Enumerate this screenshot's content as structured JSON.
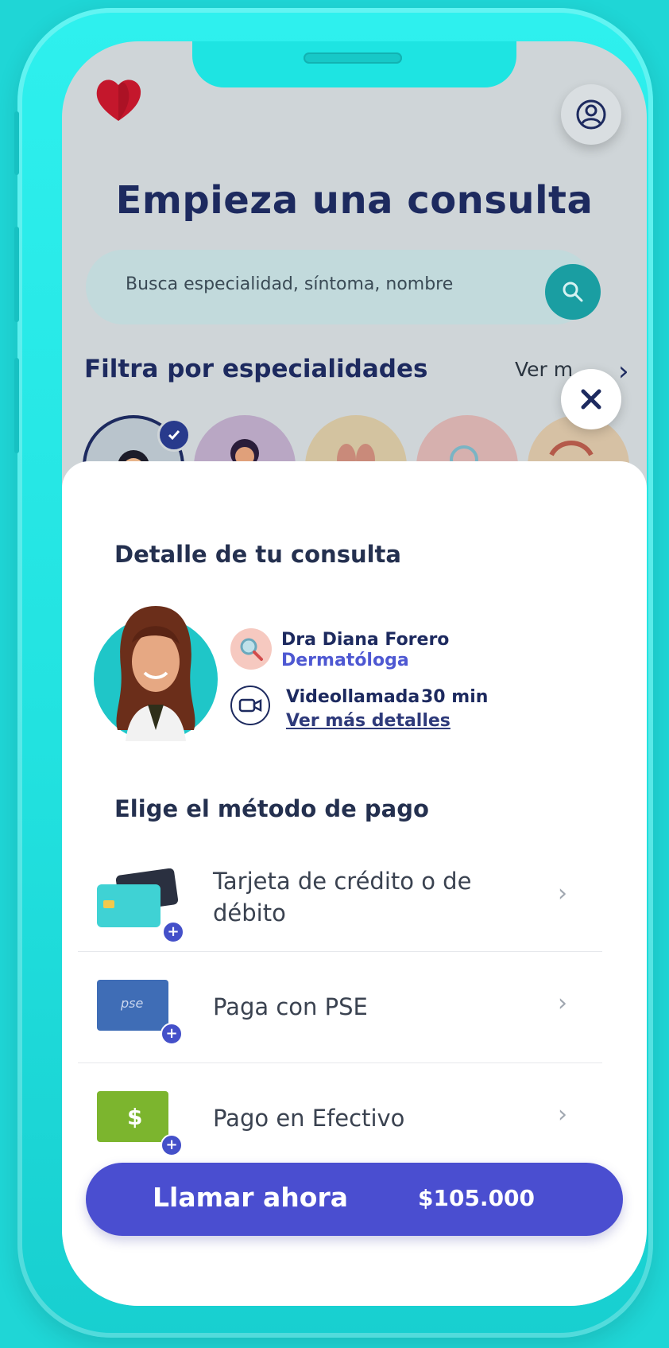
{
  "header": {
    "title": "Empieza una consulta"
  },
  "search": {
    "placeholder": "Busca especialidad, síntoma, nombre"
  },
  "filters": {
    "title": "Filtra por especialidades",
    "see_more": "Ver m"
  },
  "sheet": {
    "detail_title": "Detalle de tu consulta",
    "doctor": {
      "name": "Dra Diana Forero",
      "specialty": "Dermatóloga"
    },
    "consult": {
      "type": "Videollamada",
      "duration": "30 min",
      "details_link": "Ver más detalles"
    },
    "payment_title": "Elige el método de pago",
    "payment_methods": [
      {
        "label_line1": "Tarjeta de crédito o de",
        "label_line2": "débito"
      },
      {
        "label": "Paga con PSE",
        "badge": "pse"
      },
      {
        "label": "Pago en Efectivo",
        "badge": "$"
      }
    ]
  },
  "cta": {
    "label": "Llamar ahora",
    "price": "$105.000"
  },
  "colors": {
    "accent": "#4a4ed0",
    "title_navy": "#1d2a5f",
    "frame_teal": "#1fd6d6",
    "search_teal": "#1a9ea2",
    "logo_red": "#c4172c"
  }
}
